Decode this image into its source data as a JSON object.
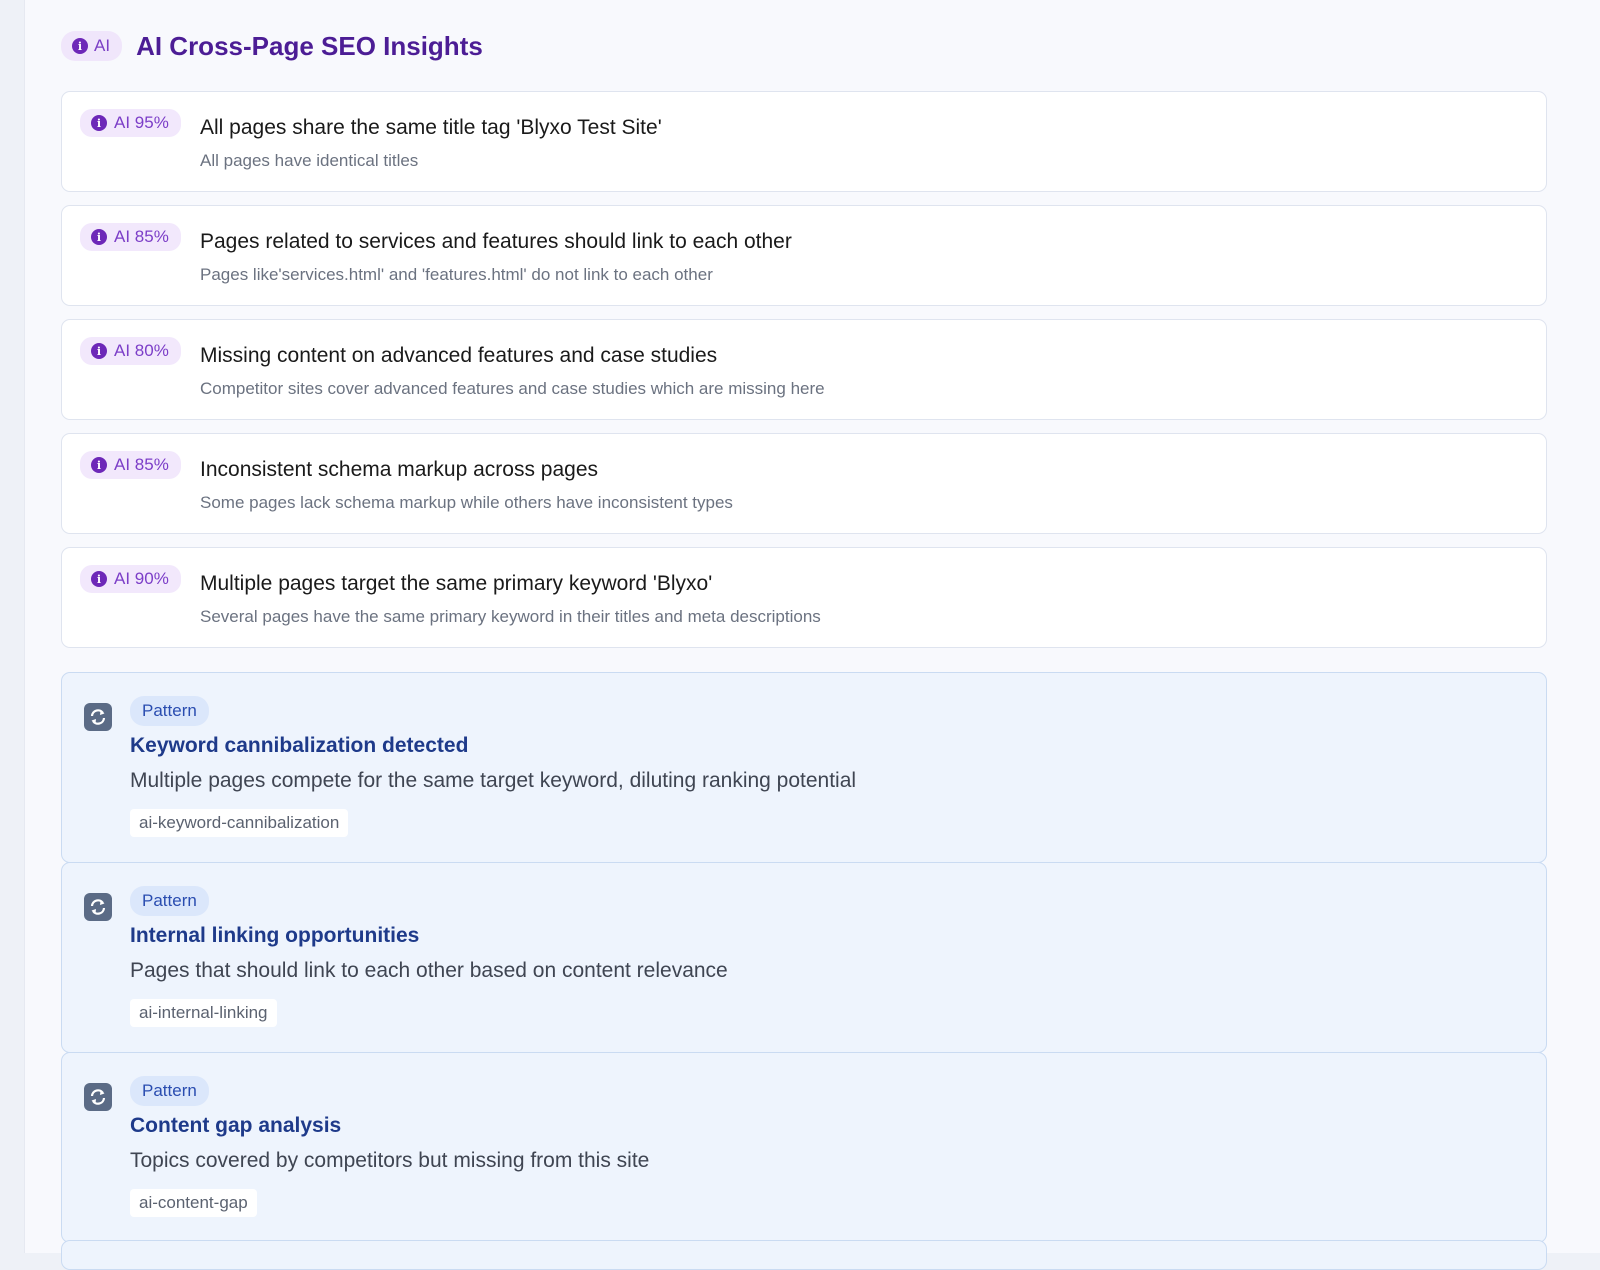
{
  "header": {
    "badge_label": "AI",
    "title": "AI Cross-Page SEO Insights"
  },
  "insights": [
    {
      "confidence": "AI 95%",
      "title": "All pages share the same title tag 'Blyxo Test Site'",
      "description": "All pages have identical titles"
    },
    {
      "confidence": "AI 85%",
      "title": "Pages related to services and features should link to each other",
      "description": "Pages like'services.html' and 'features.html' do not link to each other"
    },
    {
      "confidence": "AI 80%",
      "title": "Missing content on advanced features and case studies",
      "description": "Competitor sites cover advanced features and case studies which are missing here"
    },
    {
      "confidence": "AI 85%",
      "title": "Inconsistent schema markup across pages",
      "description": "Some pages lack schema markup while others have inconsistent types"
    },
    {
      "confidence": "AI 90%",
      "title": "Multiple pages target the same primary keyword 'Blyxo'",
      "description": "Several pages have the same primary keyword in their titles and meta descriptions"
    }
  ],
  "patterns": [
    {
      "tag": "Pattern",
      "title": "Keyword cannibalization detected",
      "description": "Multiple pages compete for the same target keyword, diluting ranking potential",
      "code": "ai-keyword-cannibalization",
      "icon": "refresh-icon"
    },
    {
      "tag": "Pattern",
      "title": "Internal linking opportunities",
      "description": "Pages that should link to each other based on content relevance",
      "code": "ai-internal-linking",
      "icon": "refresh-icon"
    },
    {
      "tag": "Pattern",
      "title": "Content gap analysis",
      "description": "Topics covered by competitors but missing from this site",
      "code": "ai-content-gap",
      "icon": "refresh-icon"
    }
  ],
  "colors": {
    "ai_accent": "#7c3ec8",
    "header_title": "#4c1d95",
    "pattern_title": "#1e3a8a",
    "pattern_background": "#eef4fd"
  }
}
